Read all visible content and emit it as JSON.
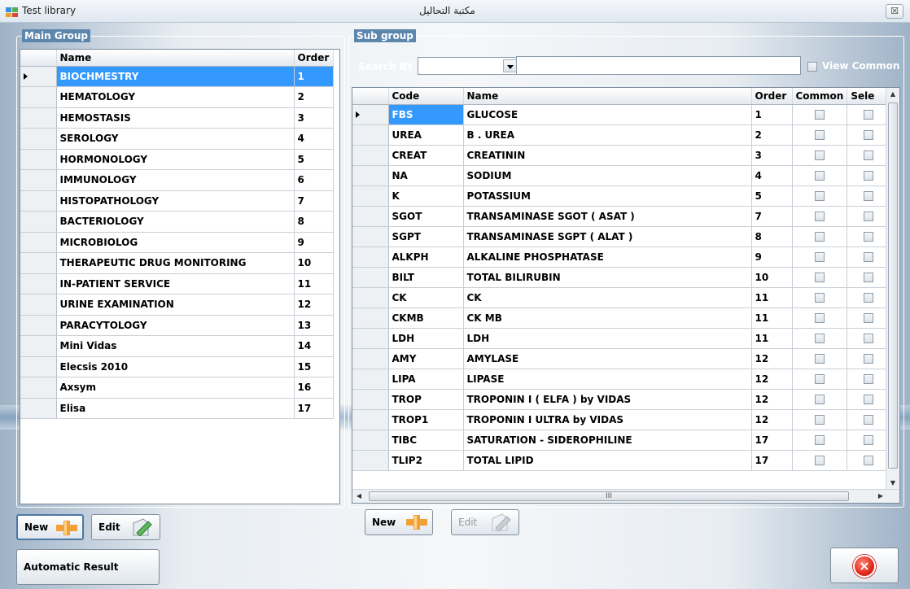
{
  "window": {
    "title": "Test library",
    "title_ar": "مكتبة التحاليل",
    "close_label": "☒"
  },
  "main_group": {
    "legend": "Main Group",
    "columns": [
      "Name",
      "Order"
    ],
    "rows": [
      {
        "name": "BIOCHMESTRY",
        "order": "1"
      },
      {
        "name": "HEMATOLOGY",
        "order": "2"
      },
      {
        "name": "HEMOSTASIS",
        "order": "3"
      },
      {
        "name": "SEROLOGY",
        "order": "4"
      },
      {
        "name": "HORMONOLOGY",
        "order": "5"
      },
      {
        "name": "IMMUNOLOGY",
        "order": "6"
      },
      {
        "name": "HISTOPATHOLOGY",
        "order": "7"
      },
      {
        "name": "BACTERIOLOGY",
        "order": "8"
      },
      {
        "name": "MICROBIOLOG",
        "order": "9"
      },
      {
        "name": "THERAPEUTIC  DRUG  MONITORING",
        "order": "10"
      },
      {
        "name": "IN-PATIENT SERVICE",
        "order": "11"
      },
      {
        "name": "URINE  EXAMINATION",
        "order": "12"
      },
      {
        "name": "PARACYTOLOGY",
        "order": "13"
      },
      {
        "name": "Mini Vidas",
        "order": "14"
      },
      {
        "name": "Elecsis 2010",
        "order": "15"
      },
      {
        "name": "Axsym",
        "order": "16"
      },
      {
        "name": "Elisa",
        "order": "17"
      }
    ],
    "selected_index": 0
  },
  "sub_group": {
    "legend": "Sub group",
    "search_label": "Search BY",
    "search_by_value": "",
    "search_text": "",
    "view_common_label": "View Common",
    "columns": [
      "Code",
      "Name",
      "Order",
      "Common",
      "Sele"
    ],
    "rows": [
      {
        "code": "FBS",
        "name": "GLUCOSE",
        "order": "1"
      },
      {
        "code": "UREA",
        "name": "B .  UREA",
        "order": "2"
      },
      {
        "code": "CREAT",
        "name": "CREATININ",
        "order": "3"
      },
      {
        "code": "NA",
        "name": "SODIUM",
        "order": "4"
      },
      {
        "code": "K",
        "name": "POTASSIUM",
        "order": "5"
      },
      {
        "code": "SGOT",
        "name": "TRANSAMINASE  SGOT ( ASAT )",
        "order": "7"
      },
      {
        "code": "SGPT",
        "name": "TRANSAMINASE  SGPT ( ALAT )",
        "order": "8"
      },
      {
        "code": "ALKPH",
        "name": "ALKALINE  PHOSPHATASE",
        "order": "9"
      },
      {
        "code": "BILT",
        "name": "TOTAL  BILIRUBIN",
        "order": "10"
      },
      {
        "code": "CK",
        "name": "CK",
        "order": "11"
      },
      {
        "code": "CKMB",
        "name": "CK MB",
        "order": "11"
      },
      {
        "code": "LDH",
        "name": "LDH",
        "order": "11"
      },
      {
        "code": "AMY",
        "name": "AMYLASE",
        "order": "12"
      },
      {
        "code": "LIPA",
        "name": "LIPASE",
        "order": "12"
      },
      {
        "code": "TROP",
        "name": "TROPONIN  I  ( ELFA ) by  VIDAS",
        "order": "12"
      },
      {
        "code": "TROP1",
        "name": "TROPONIN  I  ULTRA by VIDAS",
        "order": "12"
      },
      {
        "code": "TIBC",
        "name": "SATURATION - SIDEROPHILINE",
        "order": "17"
      },
      {
        "code": "TLIP2",
        "name": "TOTAL  LIPID",
        "order": "17"
      }
    ],
    "selected_index": 0,
    "hscroll_grip": "III"
  },
  "buttons": {
    "new_label": "New",
    "edit_label": "Edit",
    "automatic_result_label": "Automatic Result",
    "close_label": "×"
  }
}
